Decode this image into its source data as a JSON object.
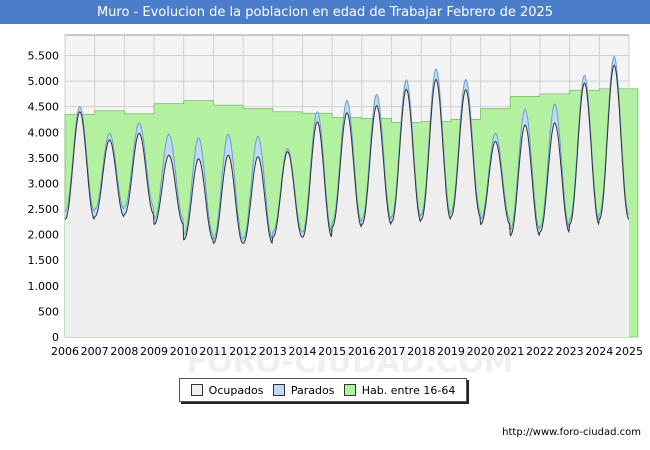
{
  "title": "Muro - Evolucion de la poblacion en edad de Trabajar Febrero de 2025",
  "watermark": "FORO-CIUDAD.COM",
  "url": "http://www.foro-ciudad.com",
  "legend": [
    {
      "label": "Ocupados",
      "color": "#eeeeee"
    },
    {
      "label": "Parados",
      "color": "#bfd9f2"
    },
    {
      "label": "Hab. entre 16-64",
      "color": "#b3f0a0"
    }
  ],
  "chart_data": {
    "type": "area",
    "x_range": [
      2006,
      2025
    ],
    "xticks": [
      "2006",
      "2007",
      "2008",
      "2009",
      "2010",
      "2011",
      "2012",
      "2013",
      "2014",
      "2015",
      "2016",
      "2017",
      "2018",
      "2019",
      "2020",
      "2021",
      "2022",
      "2023",
      "2024",
      "2025"
    ],
    "ylim": [
      0,
      5900
    ],
    "yticks": [
      "0",
      "500",
      "1.000",
      "1.500",
      "2.000",
      "2.500",
      "3.000",
      "3.500",
      "4.000",
      "4.500",
      "5.000",
      "5.500"
    ],
    "grid": true,
    "series": [
      {
        "name": "Hab. entre 16-64",
        "color": "#b3f0a0",
        "values": [
          4350,
          4420,
          4360,
          4560,
          4620,
          4530,
          4460,
          4400,
          4370,
          4290,
          4270,
          4190,
          4210,
          4250,
          4460,
          4700,
          4750,
          4820,
          4850,
          4850
        ]
      },
      {
        "name": "Parados",
        "color": "#bfd9f2",
        "peaks": [
          4500,
          3980,
          4180,
          3960,
          3890,
          3960,
          3920,
          3680,
          4400,
          4620,
          4740,
          5020,
          5240,
          5030,
          3980,
          4450,
          4550,
          5110,
          5480
        ],
        "troughs": [
          2450,
          2500,
          2550,
          2300,
          2000,
          1920,
          1920,
          2050,
          2050,
          2250,
          2300,
          2350,
          2400,
          2450,
          2300,
          2100,
          2150,
          2300,
          2400
        ]
      },
      {
        "name": "Ocupados",
        "color": "#eeeeee",
        "peaks": [
          4400,
          3850,
          3980,
          3550,
          3480,
          3550,
          3520,
          3620,
          4200,
          4380,
          4520,
          4840,
          5030,
          4830,
          3820,
          4140,
          4180,
          4960,
          5310
        ],
        "troughs": [
          2300,
          2350,
          2400,
          2200,
          1900,
          1830,
          1830,
          1950,
          1950,
          2150,
          2200,
          2250,
          2300,
          2350,
          2200,
          1980,
          2050,
          2200,
          2300
        ]
      }
    ]
  }
}
